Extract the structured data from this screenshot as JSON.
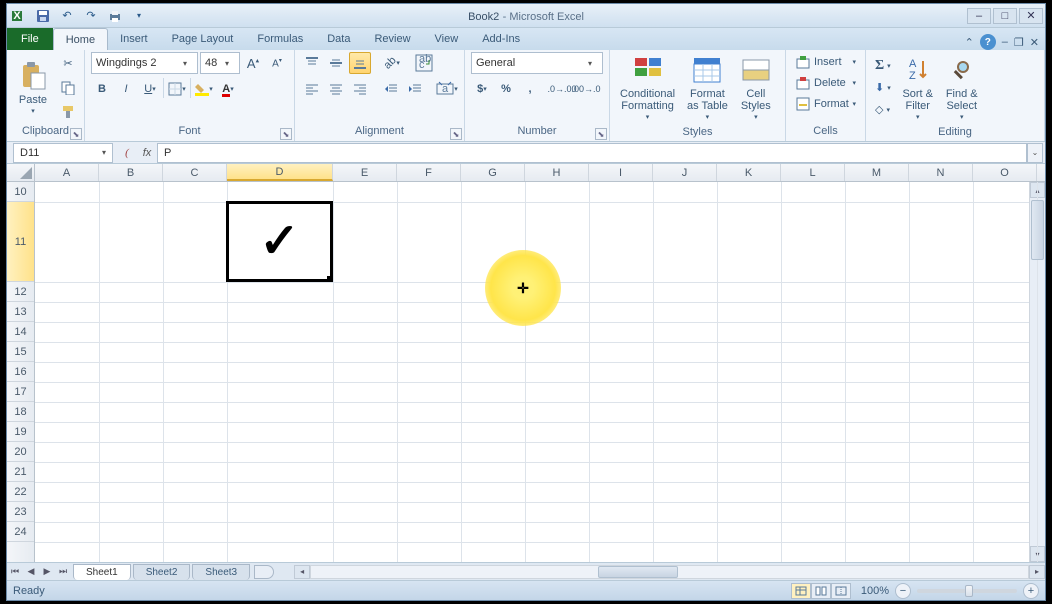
{
  "title": {
    "doc": "Book2",
    "app": "Microsoft Excel"
  },
  "tabs": {
    "file": "File",
    "list": [
      "Home",
      "Insert",
      "Page Layout",
      "Formulas",
      "Data",
      "Review",
      "View",
      "Add-Ins"
    ],
    "active": "Home"
  },
  "ribbon": {
    "clipboard": {
      "label": "Clipboard",
      "paste": "Paste"
    },
    "font": {
      "label": "Font",
      "name": "Wingdings 2",
      "size": "48",
      "bold": "B",
      "italic": "I",
      "underline": "U"
    },
    "alignment": {
      "label": "Alignment"
    },
    "number": {
      "label": "Number",
      "format": "General"
    },
    "styles": {
      "label": "Styles",
      "cond": "Conditional\nFormatting",
      "table": "Format\nas Table",
      "cell": "Cell\nStyles"
    },
    "cells": {
      "label": "Cells",
      "insert": "Insert",
      "delete": "Delete",
      "format": "Format"
    },
    "editing": {
      "label": "Editing",
      "sort": "Sort &\nFilter",
      "find": "Find &\nSelect"
    }
  },
  "formula_bar": {
    "name_box": "D11",
    "fx": "fx",
    "value": "P",
    "cancel": "✕",
    "enter": "✓"
  },
  "grid": {
    "columns": [
      "A",
      "B",
      "C",
      "D",
      "E",
      "F",
      "G",
      "H",
      "I",
      "J",
      "K",
      "L",
      "M",
      "N",
      "O"
    ],
    "rows": [
      "10",
      "11",
      "12",
      "13",
      "14",
      "15",
      "16",
      "17",
      "18",
      "19",
      "20",
      "21",
      "22",
      "23",
      "24"
    ],
    "selected_col": "D",
    "selected_row": "11",
    "cell_content_glyph": "✓",
    "col_widths": {
      "default": 64,
      "D": 106
    },
    "row_heights": {
      "default": 20,
      "11": 80
    }
  },
  "sheet_tabs": {
    "sheets": [
      "Sheet1",
      "Sheet2",
      "Sheet3"
    ],
    "active": "Sheet1"
  },
  "status": {
    "ready": "Ready",
    "zoom": "100%"
  }
}
